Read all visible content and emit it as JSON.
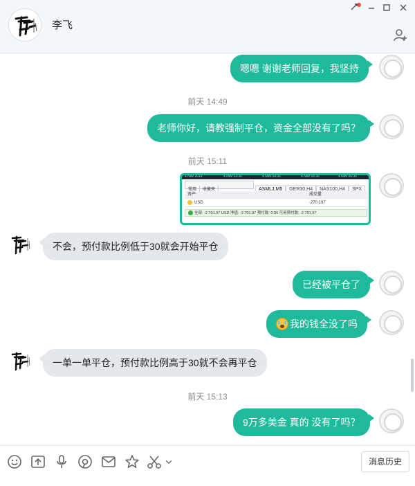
{
  "header": {
    "contact_name": "李飞"
  },
  "messages": {
    "m1": "嗯嗯 谢谢老师回复，我坚持",
    "t1": "前天 14:49",
    "m2": "老师你好，请教强制平仓，资金全部没有了吗？",
    "t2": "前天 15:11",
    "screenshot": {
      "tab_left_1": "常用",
      "tab_left_2": "收藏夹",
      "top_date_1": "4 Nov 2019",
      "top_time_1": "4 Nov 03:35",
      "top_time_2": "4 Nov 04:35",
      "top_time_3": "4 Nov 05:35",
      "top_time_4": "4 Nov 06:35",
      "tab_1": "ASMLJ,M5",
      "tab_2": "GER30,H4",
      "tab_3": "NAS100,H4",
      "tab_4": "SPX",
      "col_asset": "资产",
      "col_volume": "成交量",
      "row_currency": "USD",
      "row_value": "-270 197",
      "total_line": "全部: -2 701.97 USD  净值: -2 701.97  预付款: 0.00  可用预付款: -2 701.97"
    },
    "m3": "不会，预付款比例低于30就会开始平仓",
    "m4": "已经被平仓了",
    "m5": "我的钱全没了吗",
    "m6": "一单一单平仓，预付款比例高于30就不会再平仓",
    "t3": "前天 15:13",
    "m7": "9万多美金 真的 没有了吗？"
  },
  "toolbar": {
    "history_label": "消息历史"
  },
  "colors": {
    "outgoing_bubble": "#1fba9b",
    "incoming_bubble": "#e4e7ec",
    "header_bg": "#f3f6fb"
  },
  "icons": [
    "emoji-icon",
    "upload-icon",
    "microphone-icon",
    "screenshot-icon",
    "mail-icon",
    "star-icon",
    "scissors-icon",
    "chevron-down-icon"
  ]
}
